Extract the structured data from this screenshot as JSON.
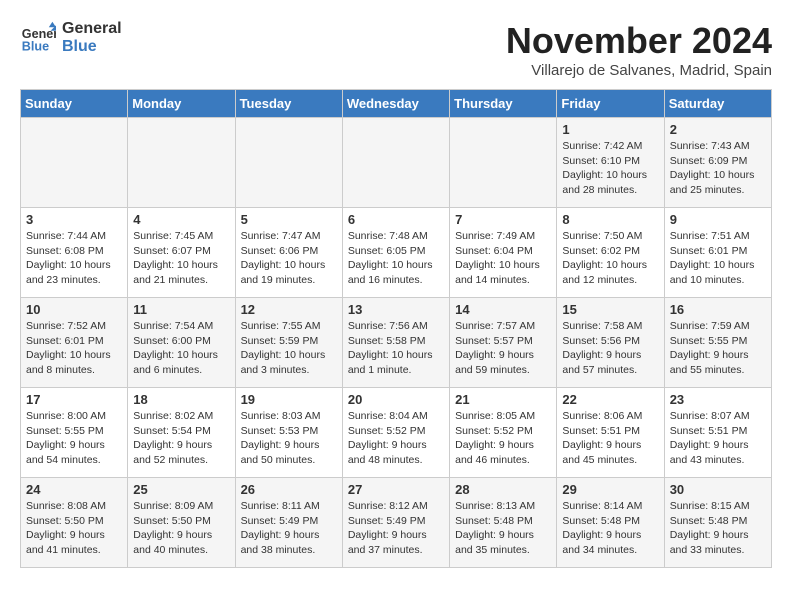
{
  "logo": {
    "line1": "General",
    "line2": "Blue"
  },
  "title": "November 2024",
  "location": "Villarejo de Salvanes, Madrid, Spain",
  "weekdays": [
    "Sunday",
    "Monday",
    "Tuesday",
    "Wednesday",
    "Thursday",
    "Friday",
    "Saturday"
  ],
  "weeks": [
    [
      {
        "day": "",
        "info": ""
      },
      {
        "day": "",
        "info": ""
      },
      {
        "day": "",
        "info": ""
      },
      {
        "day": "",
        "info": ""
      },
      {
        "day": "",
        "info": ""
      },
      {
        "day": "1",
        "info": "Sunrise: 7:42 AM\nSunset: 6:10 PM\nDaylight: 10 hours\nand 28 minutes."
      },
      {
        "day": "2",
        "info": "Sunrise: 7:43 AM\nSunset: 6:09 PM\nDaylight: 10 hours\nand 25 minutes."
      }
    ],
    [
      {
        "day": "3",
        "info": "Sunrise: 7:44 AM\nSunset: 6:08 PM\nDaylight: 10 hours\nand 23 minutes."
      },
      {
        "day": "4",
        "info": "Sunrise: 7:45 AM\nSunset: 6:07 PM\nDaylight: 10 hours\nand 21 minutes."
      },
      {
        "day": "5",
        "info": "Sunrise: 7:47 AM\nSunset: 6:06 PM\nDaylight: 10 hours\nand 19 minutes."
      },
      {
        "day": "6",
        "info": "Sunrise: 7:48 AM\nSunset: 6:05 PM\nDaylight: 10 hours\nand 16 minutes."
      },
      {
        "day": "7",
        "info": "Sunrise: 7:49 AM\nSunset: 6:04 PM\nDaylight: 10 hours\nand 14 minutes."
      },
      {
        "day": "8",
        "info": "Sunrise: 7:50 AM\nSunset: 6:02 PM\nDaylight: 10 hours\nand 12 minutes."
      },
      {
        "day": "9",
        "info": "Sunrise: 7:51 AM\nSunset: 6:01 PM\nDaylight: 10 hours\nand 10 minutes."
      }
    ],
    [
      {
        "day": "10",
        "info": "Sunrise: 7:52 AM\nSunset: 6:01 PM\nDaylight: 10 hours\nand 8 minutes."
      },
      {
        "day": "11",
        "info": "Sunrise: 7:54 AM\nSunset: 6:00 PM\nDaylight: 10 hours\nand 6 minutes."
      },
      {
        "day": "12",
        "info": "Sunrise: 7:55 AM\nSunset: 5:59 PM\nDaylight: 10 hours\nand 3 minutes."
      },
      {
        "day": "13",
        "info": "Sunrise: 7:56 AM\nSunset: 5:58 PM\nDaylight: 10 hours\nand 1 minute."
      },
      {
        "day": "14",
        "info": "Sunrise: 7:57 AM\nSunset: 5:57 PM\nDaylight: 9 hours\nand 59 minutes."
      },
      {
        "day": "15",
        "info": "Sunrise: 7:58 AM\nSunset: 5:56 PM\nDaylight: 9 hours\nand 57 minutes."
      },
      {
        "day": "16",
        "info": "Sunrise: 7:59 AM\nSunset: 5:55 PM\nDaylight: 9 hours\nand 55 minutes."
      }
    ],
    [
      {
        "day": "17",
        "info": "Sunrise: 8:00 AM\nSunset: 5:55 PM\nDaylight: 9 hours\nand 54 minutes."
      },
      {
        "day": "18",
        "info": "Sunrise: 8:02 AM\nSunset: 5:54 PM\nDaylight: 9 hours\nand 52 minutes."
      },
      {
        "day": "19",
        "info": "Sunrise: 8:03 AM\nSunset: 5:53 PM\nDaylight: 9 hours\nand 50 minutes."
      },
      {
        "day": "20",
        "info": "Sunrise: 8:04 AM\nSunset: 5:52 PM\nDaylight: 9 hours\nand 48 minutes."
      },
      {
        "day": "21",
        "info": "Sunrise: 8:05 AM\nSunset: 5:52 PM\nDaylight: 9 hours\nand 46 minutes."
      },
      {
        "day": "22",
        "info": "Sunrise: 8:06 AM\nSunset: 5:51 PM\nDaylight: 9 hours\nand 45 minutes."
      },
      {
        "day": "23",
        "info": "Sunrise: 8:07 AM\nSunset: 5:51 PM\nDaylight: 9 hours\nand 43 minutes."
      }
    ],
    [
      {
        "day": "24",
        "info": "Sunrise: 8:08 AM\nSunset: 5:50 PM\nDaylight: 9 hours\nand 41 minutes."
      },
      {
        "day": "25",
        "info": "Sunrise: 8:09 AM\nSunset: 5:50 PM\nDaylight: 9 hours\nand 40 minutes."
      },
      {
        "day": "26",
        "info": "Sunrise: 8:11 AM\nSunset: 5:49 PM\nDaylight: 9 hours\nand 38 minutes."
      },
      {
        "day": "27",
        "info": "Sunrise: 8:12 AM\nSunset: 5:49 PM\nDaylight: 9 hours\nand 37 minutes."
      },
      {
        "day": "28",
        "info": "Sunrise: 8:13 AM\nSunset: 5:48 PM\nDaylight: 9 hours\nand 35 minutes."
      },
      {
        "day": "29",
        "info": "Sunrise: 8:14 AM\nSunset: 5:48 PM\nDaylight: 9 hours\nand 34 minutes."
      },
      {
        "day": "30",
        "info": "Sunrise: 8:15 AM\nSunset: 5:48 PM\nDaylight: 9 hours\nand 33 minutes."
      }
    ]
  ]
}
